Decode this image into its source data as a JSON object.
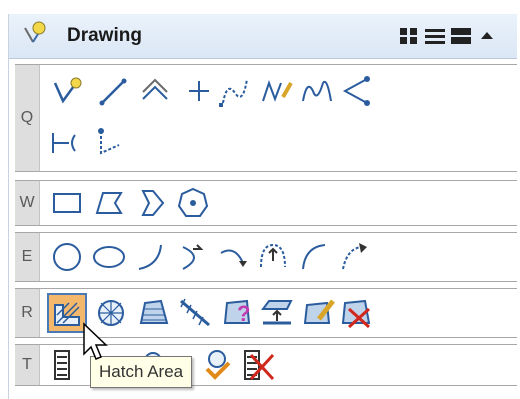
{
  "panel": {
    "title": "Drawing",
    "header_icons": [
      "pin-icon",
      "grid-view-icon",
      "list-view-icon",
      "large-view-icon",
      "collapse-icon"
    ]
  },
  "rows": [
    {
      "key": "Q",
      "tools": [
        "place-smartline",
        "place-line",
        "place-multiline",
        "place-point",
        "place-stream",
        "place-freehand",
        "place-bspline",
        "place-arc-chain",
        "place-dimension",
        "place-angle"
      ]
    },
    {
      "key": "W",
      "tools": [
        "place-block",
        "place-shape",
        "place-orthogonal-shape",
        "place-regular-polygon"
      ]
    },
    {
      "key": "E",
      "tools": [
        "place-circle",
        "place-ellipse",
        "place-arc",
        "modify-arc-radius",
        "modify-arc-angle",
        "place-half-ellipse",
        "place-quarter-ellipse",
        "modify-arc-axis"
      ]
    },
    {
      "key": "R",
      "tools": [
        "hatch-area",
        "crosshatch-area",
        "pattern-area",
        "linear-pattern",
        "show-pattern-attributes",
        "match-pattern-attributes",
        "modify-pattern",
        "delete-pattern"
      ]
    },
    {
      "key": "T",
      "tools": [
        "place-text",
        "place-note",
        "edit-text",
        "number-text",
        "spell-check",
        "delete-text"
      ]
    }
  ],
  "selected_tool": "hatch-area",
  "tooltip": "Hatch Area",
  "colors": {
    "header": "#dbe7f5",
    "selected": "#f3b86b",
    "key_bg": "#dedede",
    "icon_blue": "#2b5c9e"
  }
}
